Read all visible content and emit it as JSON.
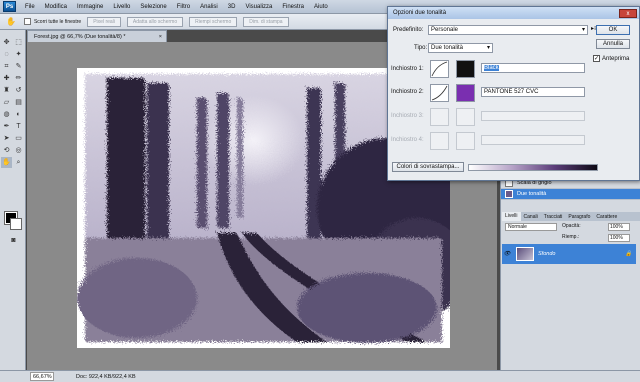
{
  "app": {
    "logo": "Ps"
  },
  "menubar": {
    "items": [
      "File",
      "Modifica",
      "Immagine",
      "Livello",
      "Selezione",
      "Filtro",
      "Analisi",
      "3D",
      "Visualizza",
      "Finestra",
      "Aiuto"
    ]
  },
  "optionsbar": {
    "checkbox_label": "Scorri tutte le finestre",
    "buttons": [
      "Pixel reali",
      "Adatta allo schermo",
      "Riempi schermo",
      "Dim. di stampa"
    ]
  },
  "document": {
    "tab_title": "Forest.jpg @ 66,7% (Due tonalità/8) *",
    "tab_close": "×"
  },
  "statusbar": {
    "zoom": "66,67%",
    "doc_info": "Doc: 922,4 KB/922,4 KB"
  },
  "dialog": {
    "title": "Opzioni due tonalità",
    "close": "x",
    "predefinito_label": "Predefinito:",
    "predefinito_value": "Personale",
    "tipo_label": "Tipo:",
    "tipo_value": "Due tonalità",
    "ink1_label": "Inchiostro 1:",
    "ink1_name": "Black",
    "ink2_label": "Inchiostro 2:",
    "ink2_name": "PANTONE 527 CVC",
    "ink3_label": "Inchiostro 3:",
    "ink4_label": "Inchiostro 4:",
    "overprint_button": "Colori di sovrastampa...",
    "ok": "OK",
    "cancel": "Annulla",
    "preview": "Anteprima",
    "ink1_color": "#111111",
    "ink2_color": "#7a2fb0"
  },
  "history": {
    "items": [
      "Scala di grigio",
      "Due tonalità"
    ]
  },
  "layers": {
    "tabs": [
      "Livelli",
      "Canali",
      "Tracciati",
      "Paragrafo",
      "Carattere"
    ],
    "blend_mode": "Normale",
    "opacity_label": "Opacità:",
    "opacity": "100%",
    "fill_label": "Riemp.:",
    "fill": "100%",
    "layer_name": "Sfondo"
  }
}
